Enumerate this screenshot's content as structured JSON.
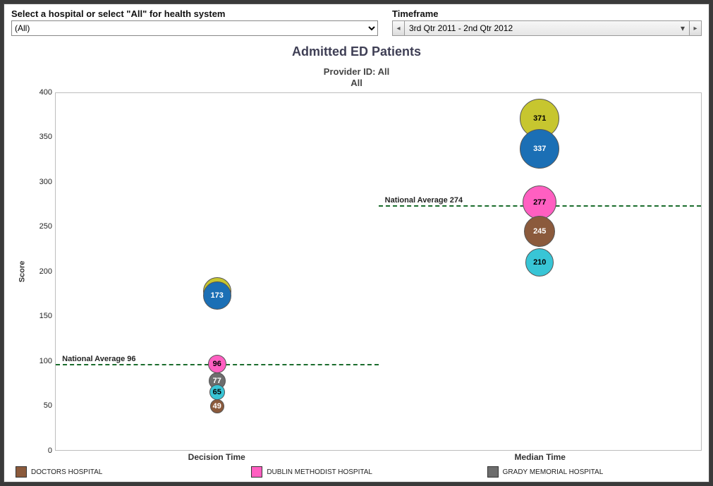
{
  "controls": {
    "hospital_label": "Select a hospital or select \"All\" for health system",
    "hospital_value": "(All)",
    "timeframe_label": "Timeframe",
    "timeframe_value": "3rd Qtr 2011 - 2nd Qtr 2012"
  },
  "titles": {
    "main": "Admitted ED Patients",
    "sub1": "Provider ID: All",
    "sub2": "All"
  },
  "legend": [
    {
      "label": "DOCTORS HOSPITAL",
      "color": "#8b5a3c"
    },
    {
      "label": "DUBLIN METHODIST HOSPITAL",
      "color": "#ff5fc1"
    },
    {
      "label": "GRADY MEMORIAL HOSPITAL",
      "color": "#6d6d6d"
    }
  ],
  "chart_data": {
    "type": "scatter",
    "title": "Admitted ED Patients",
    "subtitle": "Provider ID: All — All",
    "xlabel": "",
    "ylabel": "Score",
    "ylim": [
      0,
      400
    ],
    "yticks": [
      0,
      50,
      100,
      150,
      200,
      250,
      300,
      350,
      400
    ],
    "x_categories": [
      "Decision Time",
      "Median Time"
    ],
    "reference_lines": [
      {
        "label": "National Average 96",
        "value": 96,
        "x_span": [
          "Decision Time"
        ]
      },
      {
        "label": "National Average 274",
        "value": 274,
        "x_span": [
          "Median Time"
        ]
      }
    ],
    "series_colors": {
      "DOCTORS HOSPITAL": "#8b5a3c",
      "DUBLIN METHODIST HOSPITAL": "#ff5fc1",
      "GRADY MEMORIAL HOSPITAL": "#6d6d6d",
      "YELLOW": "#c7c62f",
      "BLUE": "#1b6fb5",
      "CYAN": "#38c5d6"
    },
    "points": [
      {
        "x": "Decision Time",
        "y": 178,
        "label": "178",
        "series": "YELLOW",
        "size": 40
      },
      {
        "x": "Decision Time",
        "y": 173,
        "label": "173",
        "series": "BLUE",
        "size": 40
      },
      {
        "x": "Decision Time",
        "y": 96,
        "label": "96",
        "series": "DUBLIN METHODIST HOSPITAL",
        "size": 26
      },
      {
        "x": "Decision Time",
        "y": 77,
        "label": "77",
        "series": "GRADY MEMORIAL HOSPITAL",
        "size": 24
      },
      {
        "x": "Decision Time",
        "y": 65,
        "label": "65",
        "series": "CYAN",
        "size": 22
      },
      {
        "x": "Decision Time",
        "y": 49,
        "label": "49",
        "series": "DOCTORS HOSPITAL",
        "size": 20
      },
      {
        "x": "Median Time",
        "y": 371,
        "label": "371",
        "series": "YELLOW",
        "size": 56
      },
      {
        "x": "Median Time",
        "y": 337,
        "label": "337",
        "series": "BLUE",
        "size": 56
      },
      {
        "x": "Median Time",
        "y": 277,
        "label": "277",
        "series": "DUBLIN METHODIST HOSPITAL",
        "size": 48
      },
      {
        "x": "Median Time",
        "y": 245,
        "label": "245",
        "series": "DOCTORS HOSPITAL",
        "size": 44
      },
      {
        "x": "Median Time",
        "y": 210,
        "label": "210",
        "series": "CYAN",
        "size": 40
      }
    ]
  }
}
